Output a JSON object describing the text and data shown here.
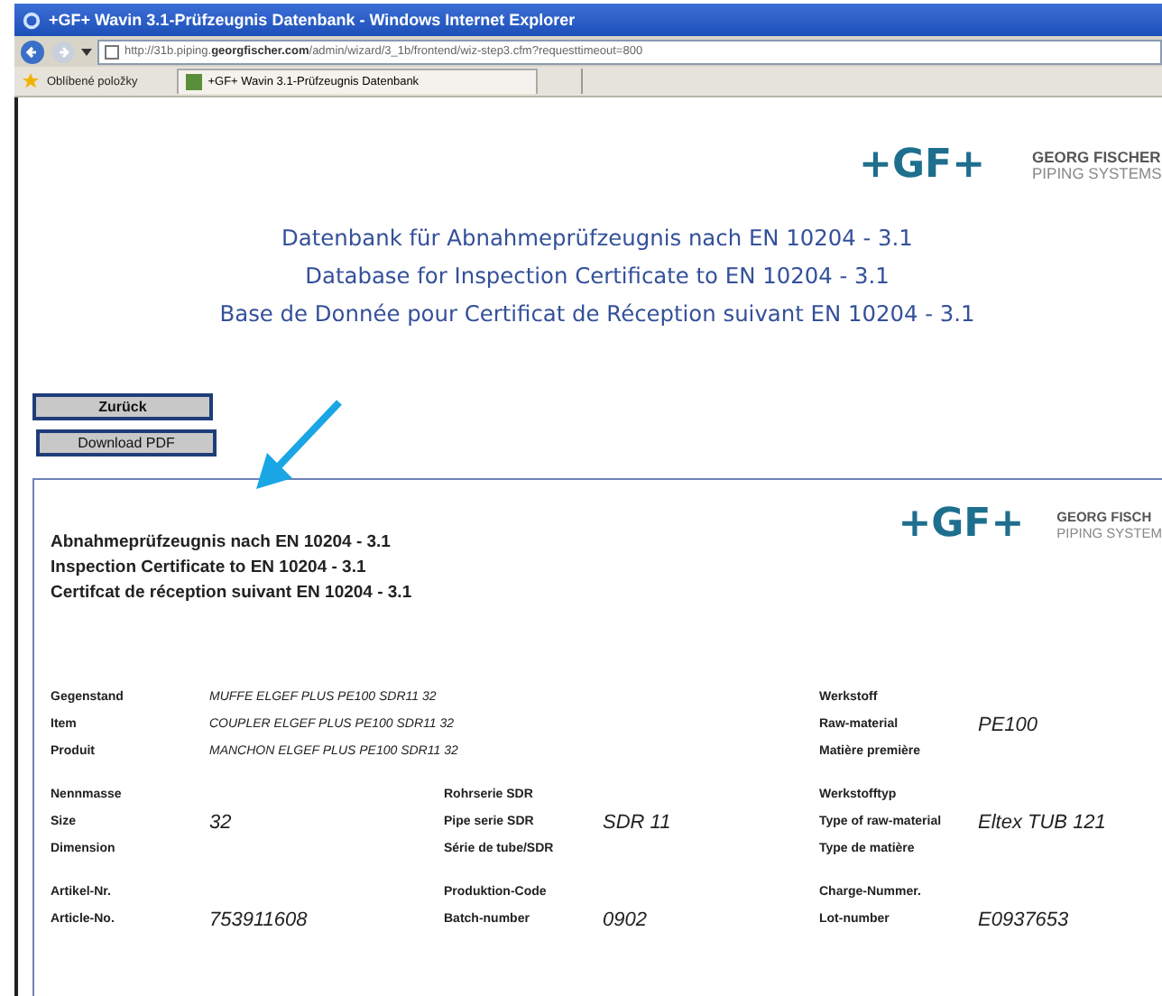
{
  "window": {
    "title": "+GF+ Wavin 3.1-Prüfzeugnis Datenbank - Windows Internet Explorer"
  },
  "address_bar": {
    "url": "http://31b.piping.**georgfischer.com**/admin/wizard/3_1b/frontend/wiz-step3.cfm?requesttimeout=800"
  },
  "favorites_bar": {
    "label": "Oblíbené položky",
    "tab": "+GF+ Wavin 3.1-Prüfzeugnis Datenbank"
  },
  "header": {
    "logo": "+GF+",
    "company": "GEORG FISCHER",
    "division": "PIPING SYSTEMS"
  },
  "headings": [
    "Datenbank für Abnahmeprüfzeugnis nach EN 10204 - 3.1",
    "Database for Inspection Certificate to EN 10204 - 3.1",
    "Base de Donnée pour Certificat de Réception suivant EN 10204 - 3.1"
  ],
  "buttons": [
    {
      "label": "Zurück",
      "bold": true
    },
    {
      "label": "Download PDF",
      "bold": false
    }
  ],
  "certificate": {
    "logo": "+GF+",
    "company": "GEORG FISCH",
    "division": "PIPING SYSTEM",
    "titles": [
      "Abnahmeprüfzeugnis nach EN 10204 - 3.1",
      "Inspection Certificate to EN 10204 - 3.1",
      "Certifcat de réception suivant EN 10204 - 3.1"
    ],
    "sections": [
      {
        "fields": [
          {
            "kind": "wide",
            "lines": [
              {
                "label": "Gegenstand",
                "value": "MUFFE ELGEF PLUS PE100 SDR11 32"
              },
              {
                "label": "Item",
                "value": "COUPLER ELGEF PLUS PE100 SDR11 32"
              },
              {
                "label": "Produit",
                "value": "MANCHON ELGEF PLUS PE100 SDR11 32"
              }
            ]
          },
          {
            "kind": "normal",
            "lines": [
              {
                "label": "Werkstoff"
              },
              {
                "label": "Raw-material",
                "value": "PE100"
              },
              {
                "label": "Matière première"
              }
            ]
          }
        ]
      },
      {
        "fields": [
          {
            "kind": "normal",
            "lines": [
              {
                "label": "Nennmasse"
              },
              {
                "label": "Size",
                "value": "32"
              },
              {
                "label": "Dimension"
              }
            ]
          },
          {
            "kind": "normal",
            "lines": [
              {
                "label": "Rohrserie SDR"
              },
              {
                "label": "Pipe serie SDR",
                "value": "SDR 11"
              },
              {
                "label": "Série de tube/SDR"
              }
            ]
          },
          {
            "kind": "normal",
            "lines": [
              {
                "label": "Werkstofftyp"
              },
              {
                "label": "Type of raw-material",
                "value": "Eltex TUB 121"
              },
              {
                "label": "Type de matière"
              }
            ]
          }
        ]
      },
      {
        "fields": [
          {
            "kind": "normal",
            "lines": [
              {
                "label": "Artikel-Nr."
              },
              {
                "label": "Article-No.",
                "value": "753911608"
              }
            ]
          },
          {
            "kind": "normal",
            "lines": [
              {
                "label": "Produktion-Code"
              },
              {
                "label": "Batch-number",
                "value": "0902"
              }
            ]
          },
          {
            "kind": "normal",
            "lines": [
              {
                "label": "Charge-Nummer."
              },
              {
                "label": "Lot-number",
                "value": "E0937653"
              }
            ]
          }
        ]
      }
    ]
  }
}
